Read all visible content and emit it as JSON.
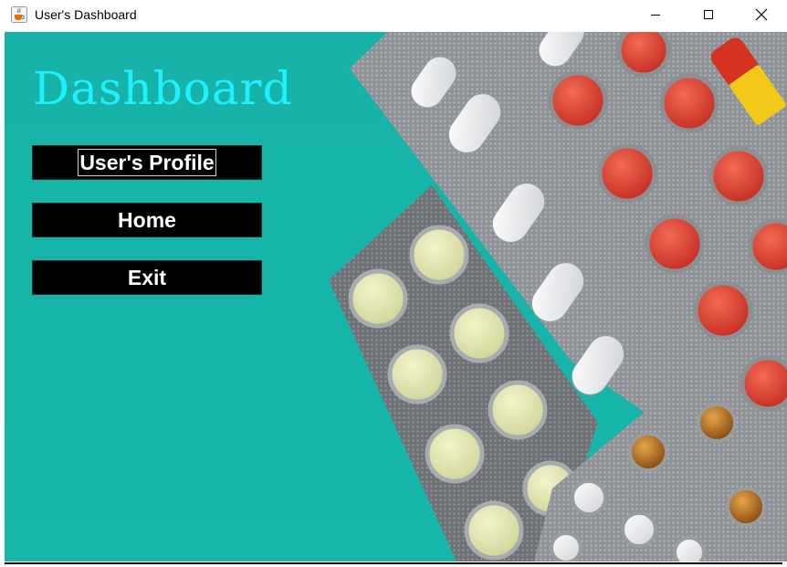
{
  "window": {
    "title": "User's Dashboard",
    "app_icon": "java-cup-icon",
    "controls": [
      "minimize-icon",
      "maximize-icon",
      "close-icon"
    ]
  },
  "dashboard": {
    "title": "Dashboard",
    "title_color": "#1ff0ff",
    "background_color": "#17b3a8",
    "background_image": "pill-blister-packs-photo"
  },
  "menu": {
    "profile_label": "User's Profile",
    "home_label": "Home",
    "exit_label": "Exit"
  }
}
